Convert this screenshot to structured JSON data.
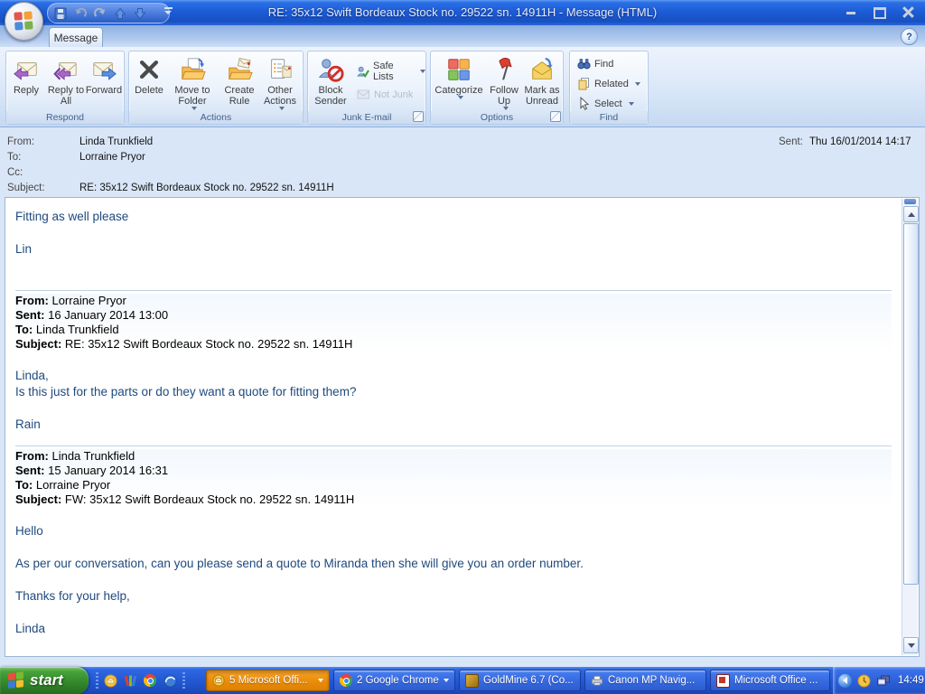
{
  "window": {
    "title": "RE: 35x12 Swift Bordeaux Stock no. 29522 sn. 14911H - Message (HTML)"
  },
  "tabs": {
    "message": "Message"
  },
  "ribbon": {
    "respond": {
      "caption": "Respond",
      "reply": "Reply",
      "reply_all": "Reply to All",
      "forward": "Forward"
    },
    "actions": {
      "caption": "Actions",
      "delete": "Delete",
      "move_to_folder": "Move to Folder",
      "create_rule": "Create Rule",
      "other_actions": "Other Actions"
    },
    "junk": {
      "caption": "Junk E-mail",
      "block_sender": "Block Sender",
      "safe_lists": "Safe Lists",
      "not_junk": "Not Junk"
    },
    "options": {
      "caption": "Options",
      "categorize": "Categorize",
      "follow_up": "Follow Up",
      "mark_as_unread": "Mark as Unread"
    },
    "find": {
      "caption": "Find",
      "find": "Find",
      "related": "Related",
      "select": "Select"
    }
  },
  "header": {
    "from_label": "From:",
    "from_value": "Linda Trunkfield",
    "to_label": "To:",
    "to_value": "Lorraine Pryor",
    "cc_label": "Cc:",
    "cc_value": "",
    "subject_label": "Subject:",
    "subject_value": "RE: 35x12 Swift Bordeaux Stock no. 29522 sn. 14911H",
    "sent_label": "Sent:",
    "sent_value": "Thu 16/01/2014 14:17"
  },
  "message": {
    "reply_line1": "Fitting as well please",
    "reply_line2": "Lin",
    "quote1": {
      "from_label": "From:",
      "from": "Lorraine Pryor",
      "sent_label": "Sent:",
      "sent": "16 January 2014 13:00",
      "to_label": "To:",
      "to": "Linda Trunkfield",
      "subject_label": "Subject:",
      "subject": "RE: 35x12 Swift Bordeaux Stock no. 29522 sn. 14911H",
      "line1": "Linda,",
      "line2": "Is this just for the parts or do they want a quote for fitting them?",
      "line3": "Rain"
    },
    "quote2": {
      "from_label": "From:",
      "from": "Linda Trunkfield",
      "sent_label": "Sent:",
      "sent": "15 January 2014 16:31",
      "to_label": "To:",
      "to": "Lorraine Pryor",
      "subject_label": "Subject:",
      "subject": "FW: 35x12 Swift Bordeaux Stock no. 29522 sn. 14911H",
      "line1": "Hello",
      "line2": "As per our conversation, can you please send a quote to Miranda then she will give you an order number.",
      "line3": "Thanks for your help,",
      "line4": "Linda"
    }
  },
  "taskbar": {
    "start_label": "start",
    "buttons": [
      {
        "label": "5 Microsoft Offi...",
        "state": "active"
      },
      {
        "label": "2 Google Chrome",
        "state": "normal"
      },
      {
        "label": "GoldMine 6.7 (Co...",
        "state": "normal"
      },
      {
        "label": "Canon MP Navig...",
        "state": "normal"
      },
      {
        "label": "Microsoft Office ...",
        "state": "normal"
      }
    ],
    "clock": "14:49"
  },
  "icons": {
    "help_glyph": "?"
  },
  "colors": {
    "reply_text_blue": "#1F497D",
    "titlebar_blue": "#1d5cd6",
    "taskbar_blue": "#2257d1",
    "active_task_orange": "#e98b08",
    "start_green": "#33862a"
  }
}
